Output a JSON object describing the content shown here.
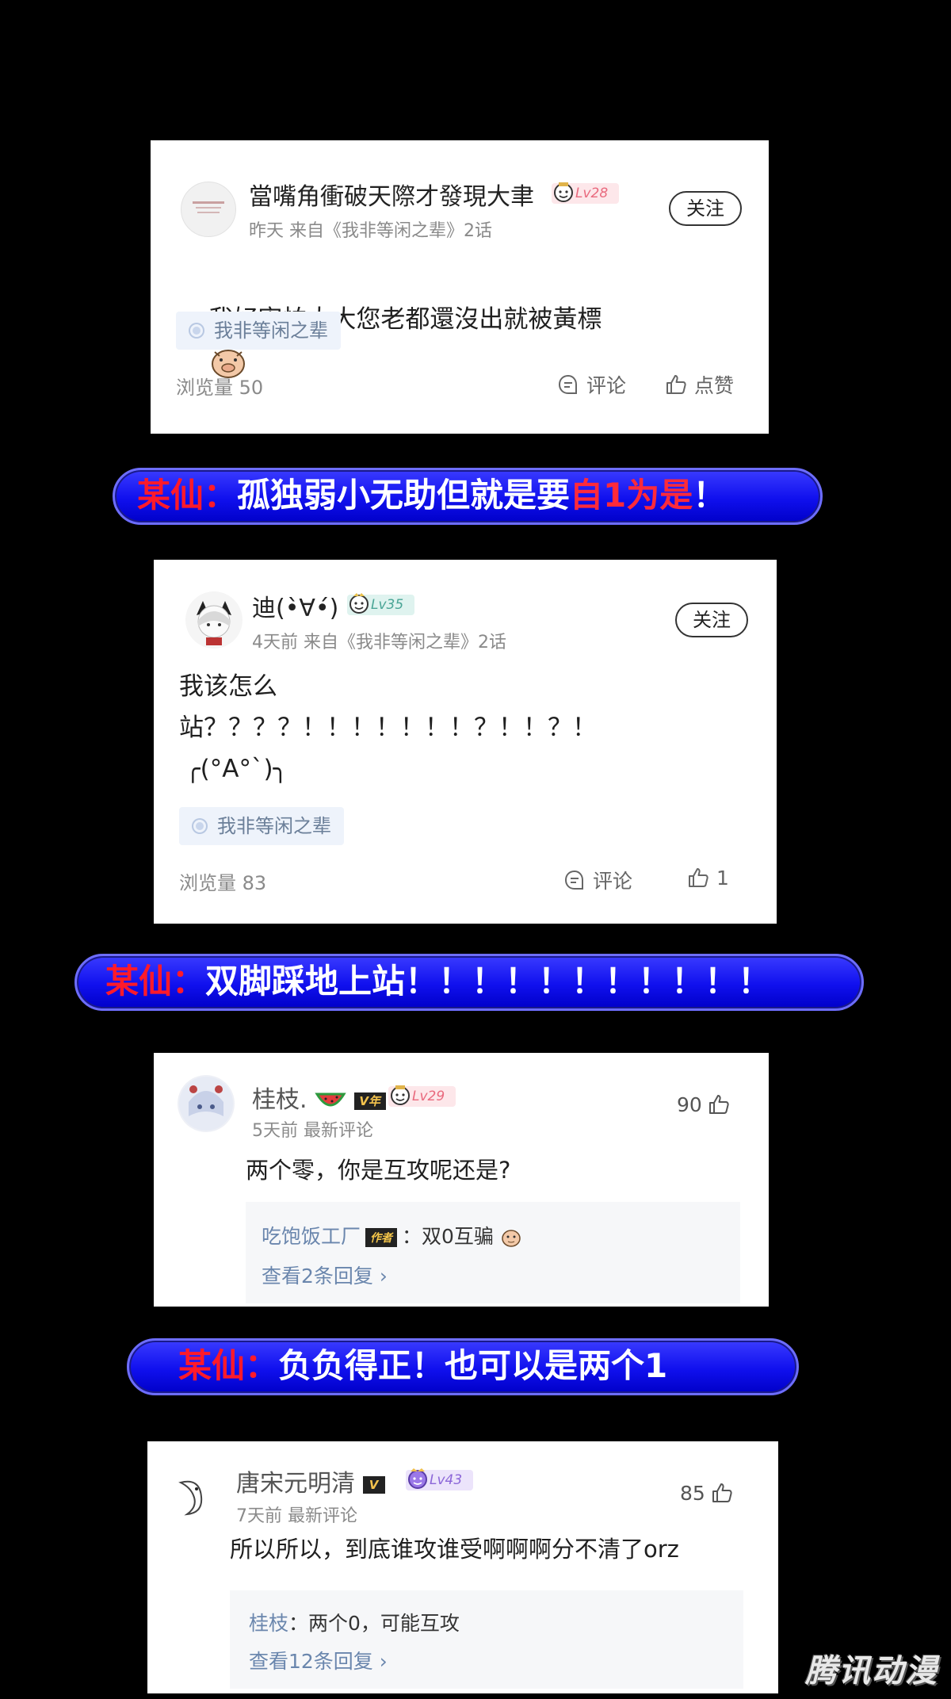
{
  "comment1": {
    "username": "當嘴角衝破天際才發現大聿",
    "level": "Lv28",
    "meta": "昨天 来自《我非等闲之辈》2话",
    "follow_label": "关注",
    "body": "我好害怕大大您老都還沒出就被黃標",
    "tag": "我非等闲之辈",
    "views": "浏览量 50",
    "comment_label": "评论",
    "like_label": "点赞"
  },
  "banner1": {
    "speaker": "某仙：",
    "text_a": "孤独弱小无助但就是要",
    "highlight": "自1为是",
    "text_b": "！"
  },
  "comment2": {
    "username": "迪(•̀∀•́)",
    "level": "Lv35",
    "meta": "4天前 来自《我非等闲之辈》2话",
    "follow_label": "关注",
    "body_line1": "我该怎么",
    "body_line2": "站？？？？！！！！！！！？！！？！",
    "body_line3": "╭(°A°`)╮",
    "tag": "我非等闲之辈",
    "views": "浏览量 83",
    "comment_label": "评论",
    "like_count": "1"
  },
  "banner2": {
    "speaker": "某仙：",
    "text": "双脚踩地上站！！！！！！！！！！！"
  },
  "comment3": {
    "username": "桂枝.",
    "vip": "V年",
    "level": "Lv29",
    "meta": "5天前 最新评论",
    "like_count": "90",
    "body": "两个零，你是互攻呢还是?",
    "reply_name": "吃饱饭工厂",
    "author_badge": "作者",
    "reply_text": "：双0互骗",
    "more_replies": "查看2条回复 ›"
  },
  "banner3": {
    "speaker": "某仙：",
    "text": "负负得正！也可以是两个1"
  },
  "comment4": {
    "username": "唐宋元明清",
    "vip": "V",
    "level": "Lv43",
    "meta": "7天前 最新评论",
    "like_count": "85",
    "body": "所以所以，到底谁攻谁受啊啊啊分不清了orz",
    "reply_name": "桂枝",
    "reply_text": "：两个0，可能互攻",
    "more_replies": "查看12条回复 ›"
  },
  "watermark": "腾讯动漫",
  "colors": {
    "banner_blue": "#1010ee",
    "speaker_red": "#ff1a2a",
    "link_blue": "#6a86ad"
  }
}
